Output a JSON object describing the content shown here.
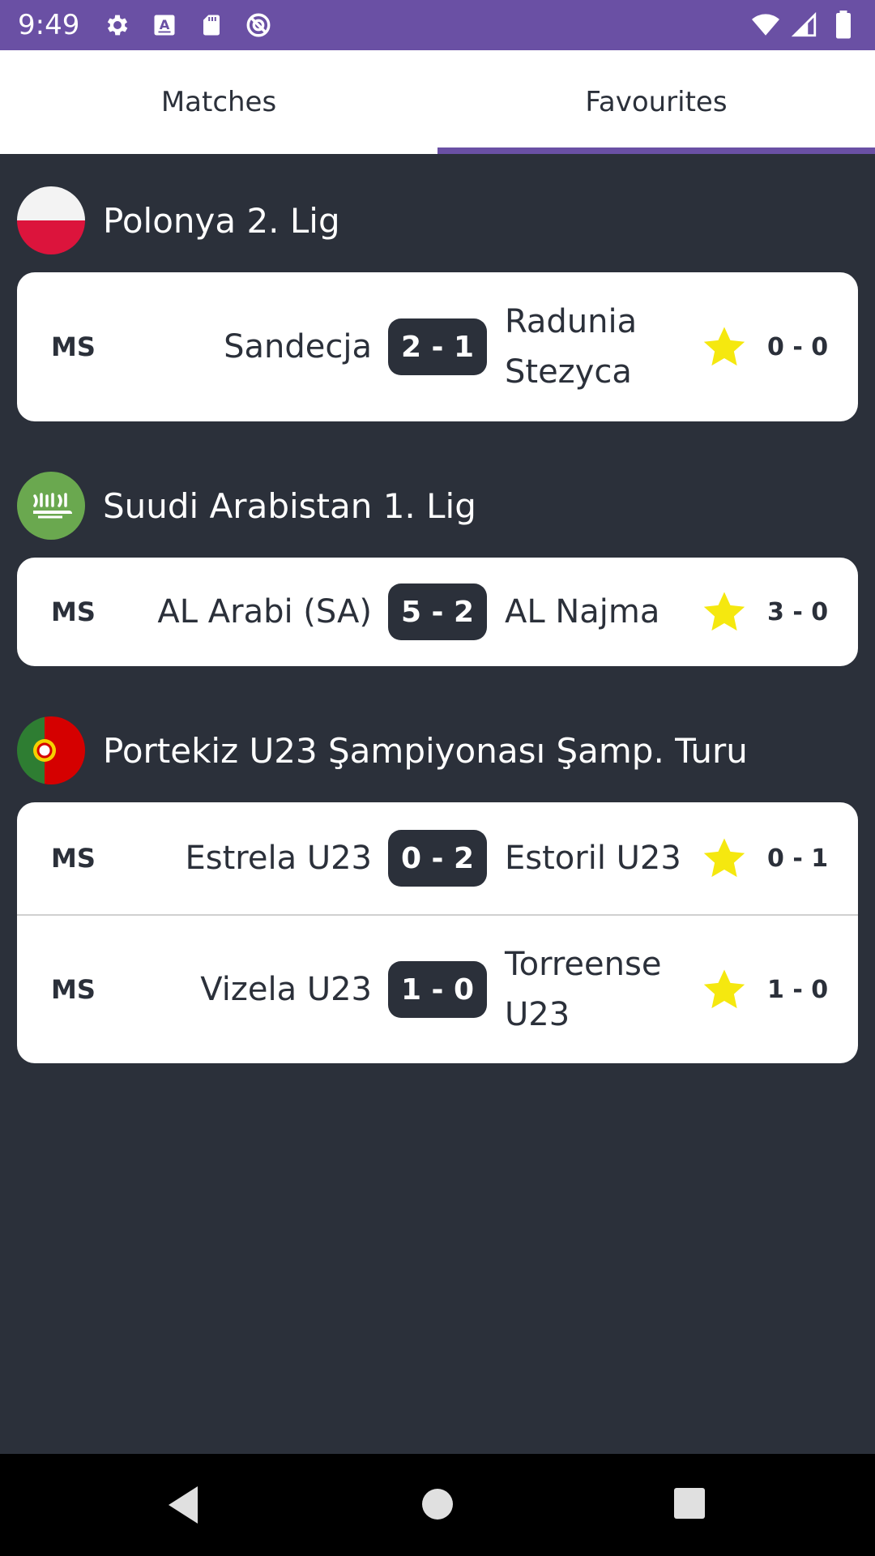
{
  "status_bar": {
    "time": "9:49",
    "icons_left": [
      "gear-icon",
      "a-keyboard-icon",
      "sd-card-icon",
      "no-disturb-icon"
    ],
    "icons_right": [
      "wifi-icon",
      "signal-icon",
      "battery-icon"
    ]
  },
  "tabs": [
    {
      "label": "Matches",
      "active": false
    },
    {
      "label": "Favourites",
      "active": true
    }
  ],
  "leagues": [
    {
      "name": "Polonya 2. Lig",
      "flag": "poland-flag-icon",
      "matches": [
        {
          "status": "MS",
          "home": "Sandecja",
          "score": "2 - 1",
          "away": "Radunia Stezyca",
          "half_time": "0 - 0",
          "favourite": true
        }
      ]
    },
    {
      "name": "Suudi Arabistan 1. Lig",
      "flag": "saudi-arabia-flag-icon",
      "matches": [
        {
          "status": "MS",
          "home": "AL Arabi (SA)",
          "score": "5 - 2",
          "away": "AL Najma",
          "half_time": "3 - 0",
          "favourite": true
        }
      ]
    },
    {
      "name": "Portekiz U23 Şampiyonası Şamp. Turu",
      "flag": "portugal-flag-icon",
      "matches": [
        {
          "status": "MS",
          "home": "Estrela U23",
          "score": "0 - 2",
          "away": "Estoril U23",
          "half_time": "0 - 1",
          "favourite": true
        },
        {
          "status": "MS",
          "home": "Vizela U23",
          "score": "1 - 0",
          "away": "Torreense U23",
          "half_time": "1 - 0",
          "favourite": true
        }
      ]
    }
  ],
  "nav_bar": {
    "buttons": [
      "back-icon",
      "home-icon",
      "recents-icon"
    ]
  },
  "colors": {
    "accent": "#6a50a4",
    "background": "#2b303a",
    "card": "#ffffff",
    "star": "#f5e80f"
  }
}
